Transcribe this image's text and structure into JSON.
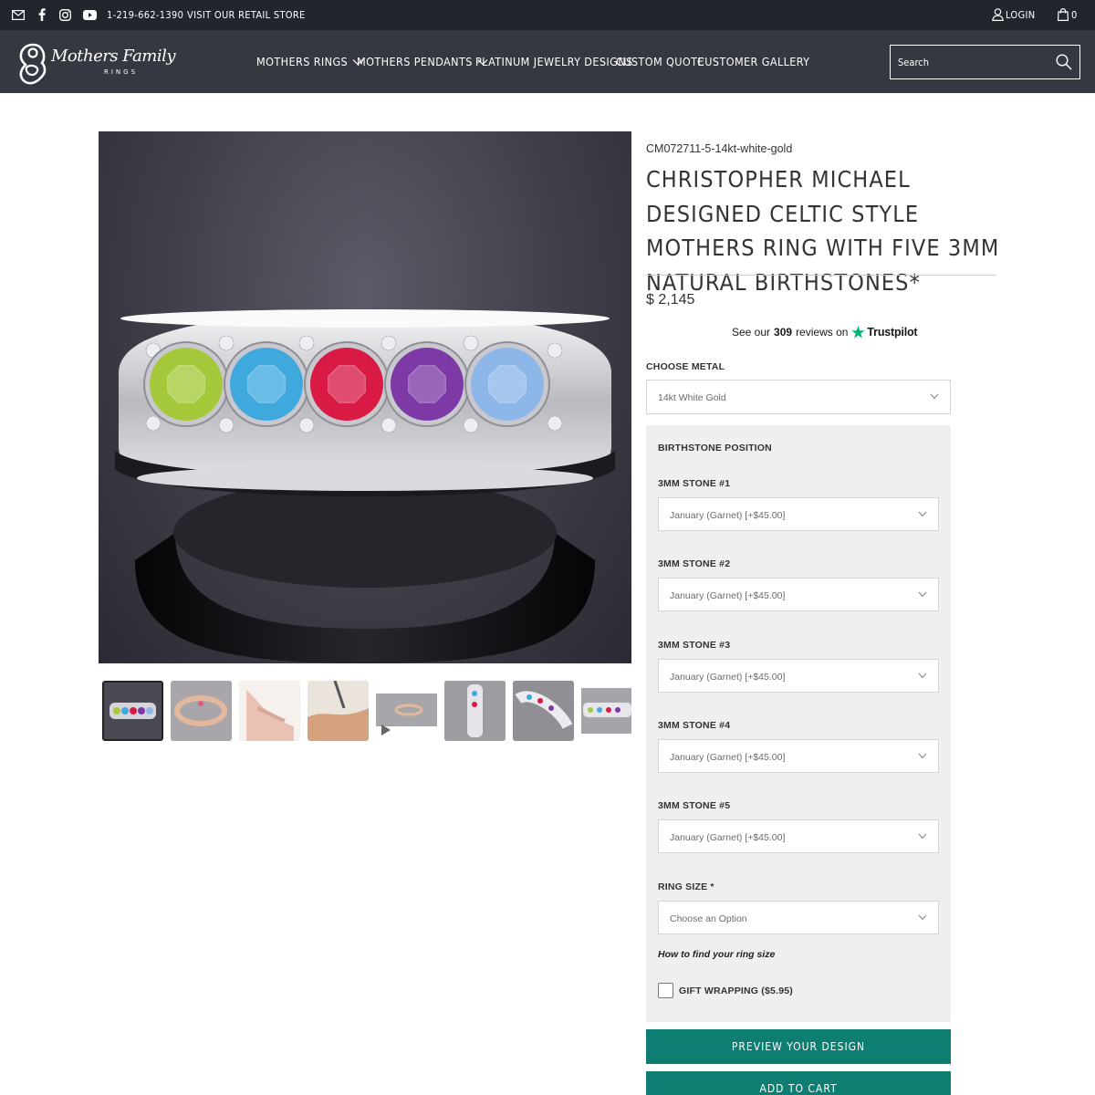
{
  "topbar": {
    "phone": "1-219-662-1390",
    "retail_link": "VISIT OUR RETAIL STORE",
    "login": "LOGIN",
    "cart_count": "0",
    "icons": [
      "mail-icon",
      "facebook-icon",
      "instagram-icon",
      "youtube-icon",
      "user-icon",
      "shopping-bag-icon"
    ]
  },
  "header": {
    "logo_text": "Mothers Family",
    "logo_sub": "RINGS",
    "nav": [
      {
        "label": "MOTHERS RINGS",
        "has_dropdown": true
      },
      {
        "label": "MOTHERS PENDANTS",
        "has_dropdown": true
      },
      {
        "label": "PLATINUM JEWELRY DESIGNS",
        "has_dropdown": false
      },
      {
        "label": "CUSTOM QUOTE",
        "has_dropdown": false
      },
      {
        "label": "CUSTOMER GALLERY",
        "has_dropdown": false
      }
    ],
    "search_placeholder": "Search"
  },
  "product": {
    "sku": "CM072711-5-14kt-white-gold",
    "title": "CHRISTOPHER MICHAEL DESIGNED CELTIC STYLE MOTHERS RING WITH FIVE 3MM NATURAL BIRTHSTONES*",
    "price": "$ 2,145",
    "trustpilot": {
      "prefix": "See our",
      "count": "309",
      "suffix": "reviews on",
      "brand": "Trustpilot"
    },
    "gem_colors": [
      "#a6c93c",
      "#3fa9de",
      "#d81a45",
      "#7d3aa6",
      "#8cb7e8"
    ],
    "thumbnail_count": 8
  },
  "options": {
    "metal_label": "CHOOSE METAL",
    "metal_value": "14kt White Gold",
    "panel_title": "BIRTHSTONE POSITION",
    "stones": [
      {
        "label": "3MM STONE #1",
        "value": "January (Garnet) [+$45.00]"
      },
      {
        "label": "3MM STONE #2",
        "value": "January (Garnet) [+$45.00]"
      },
      {
        "label": "3MM STONE #3",
        "value": "January (Garnet) [+$45.00]"
      },
      {
        "label": "3MM STONE #4",
        "value": "January (Garnet) [+$45.00]"
      },
      {
        "label": "3MM STONE #5",
        "value": "January (Garnet) [+$45.00]"
      }
    ],
    "ring_size_label": "RING SIZE *",
    "ring_size_value": "Choose an Option",
    "howto_link": "How to find your ring size",
    "gift_label": "GIFT WRAPPING ($5.95)"
  },
  "buttons": {
    "preview": "PREVIEW YOUR DESIGN",
    "add_to_cart": "ADD TO CART"
  },
  "colors": {
    "topbar_bg": "#22252c",
    "header_bg": "#343840",
    "accent": "#0e7e73",
    "trustpilot_green": "#00b67a",
    "panel_bg": "#eef0ef"
  }
}
